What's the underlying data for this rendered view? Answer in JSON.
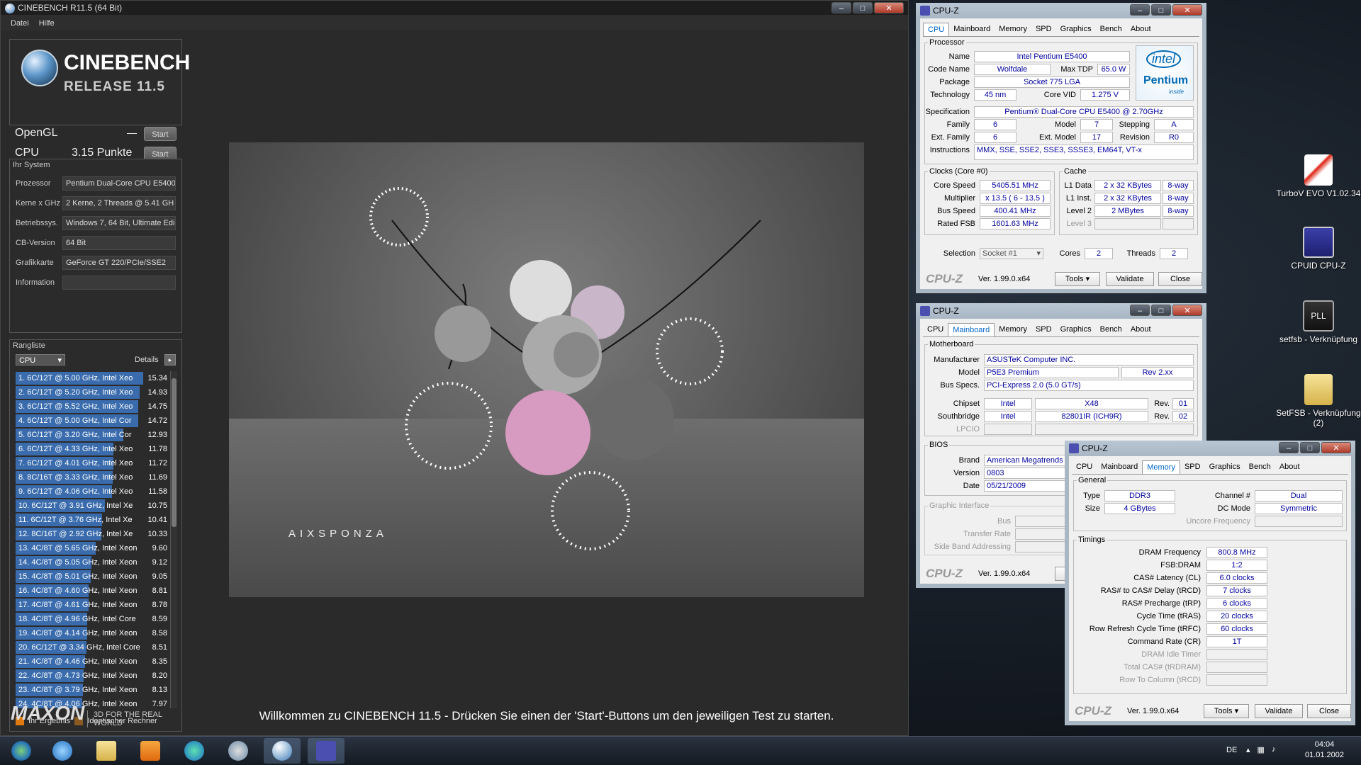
{
  "cinebench": {
    "title": "CINEBENCH R11.5 (64 Bit)",
    "menu": [
      "Datei",
      "Hilfe"
    ],
    "logo_line1": "CINEBENCH",
    "logo_line2": "RELEASE 11.5",
    "opengl_label": "OpenGL",
    "opengl_value": "—",
    "cpu_label": "CPU",
    "cpu_value": "3.15 Punkte",
    "start": "Start",
    "system_title": "Ihr System",
    "system": [
      {
        "k": "Prozessor",
        "v": "Pentium Dual-Core CPU E5400"
      },
      {
        "k": "Kerne x GHz",
        "v": "2 Kerne, 2 Threads @ 5.41 GH"
      },
      {
        "k": "Betriebssys.",
        "v": "Windows 7, 64 Bit, Ultimate Edi"
      },
      {
        "k": "CB-Version",
        "v": "64 Bit"
      },
      {
        "k": "Grafikkarte",
        "v": "GeForce GT 220/PCIe/SSE2"
      },
      {
        "k": "Information",
        "v": ""
      }
    ],
    "rank_title": "Rangliste",
    "rank_select": "CPU",
    "rank_details": "Details",
    "ranking": [
      {
        "t": "1. 6C/12T @ 5.00 GHz, Intel Xeo",
        "s": "15.34"
      },
      {
        "t": "2. 6C/12T @ 5.20 GHz, Intel Xeo",
        "s": "14.93"
      },
      {
        "t": "3. 6C/12T @ 5.52 GHz, Intel Xeo",
        "s": "14.75"
      },
      {
        "t": "4. 6C/12T @ 5.00 GHz, Intel Cor",
        "s": "14.72"
      },
      {
        "t": "5. 6C/12T @ 3.20 GHz, Intel Cor",
        "s": "12.93"
      },
      {
        "t": "6. 6C/12T @ 4.33 GHz, Intel Xeo",
        "s": "11.78"
      },
      {
        "t": "7. 6C/12T @ 4.01 GHz, Intel Xeo",
        "s": "11.72"
      },
      {
        "t": "8. 8C/16T @ 3.33 GHz, Intel Xeo",
        "s": "11.69"
      },
      {
        "t": "9. 6C/12T @ 4.06 GHz, Intel Xeo",
        "s": "11.58"
      },
      {
        "t": "10. 6C/12T @ 3.91 GHz, Intel Xe",
        "s": "10.75"
      },
      {
        "t": "11. 6C/12T @ 3.76 GHz, Intel Xe",
        "s": "10.41"
      },
      {
        "t": "12. 8C/16T @ 2.92 GHz, Intel Xe",
        "s": "10.33"
      },
      {
        "t": "13. 4C/8T @ 5.65 GHz, Intel Xeon",
        "s": "9.60"
      },
      {
        "t": "14. 4C/8T @ 5.05 GHz, Intel Xeon",
        "s": "9.12"
      },
      {
        "t": "15. 4C/8T @ 5.01 GHz, Intel Xeon",
        "s": "9.05"
      },
      {
        "t": "16. 4C/8T @ 4.60 GHz, Intel Xeon",
        "s": "8.81"
      },
      {
        "t": "17. 4C/8T @ 4.61 GHz, Intel Xeon",
        "s": "8.78"
      },
      {
        "t": "18. 4C/8T @ 4.96 GHz, Intel Core",
        "s": "8.59"
      },
      {
        "t": "19. 4C/8T @ 4.14 GHz, Intel Xeon",
        "s": "8.58"
      },
      {
        "t": "20. 6C/12T @ 3.34 GHz, Intel Core",
        "s": "8.51"
      },
      {
        "t": "21. 4C/8T @ 4.46 GHz, Intel Xeon",
        "s": "8.35"
      },
      {
        "t": "22. 4C/8T @ 4.73 GHz, Intel Xeon",
        "s": "8.20"
      },
      {
        "t": "23. 4C/8T @ 3.79 GHz, Intel Xeon",
        "s": "8.13"
      },
      {
        "t": "24. 4C/8T @ 4.06 GHz, Intel Xeon",
        "s": "7.97"
      }
    ],
    "legend_yours": "Ihr Ergebnis",
    "legend_identical": "Identischer Rechner",
    "maxon": "MAXON",
    "maxon_sub": "3D FOR THE REAL WORLD",
    "render_brand": "AIXSPONZA",
    "welcome": "Willkommen zu CINEBENCH 11.5 - Drücken Sie einen der 'Start'-Buttons um den jeweiligen Test zu starten."
  },
  "cpuz_tabs": [
    "CPU",
    "Mainboard",
    "Memory",
    "SPD",
    "Graphics",
    "Bench",
    "About"
  ],
  "cpuz_title": "CPU-Z",
  "cpuz_footer": {
    "brand": "CPU-Z",
    "version": "Ver. 1.99.0.x64",
    "tools": "Tools",
    "validate": "Validate",
    "close": "Close"
  },
  "cpu": {
    "processor": "Processor",
    "name_l": "Name",
    "name": "Intel Pentium E5400",
    "code_l": "Code Name",
    "code": "Wolfdale",
    "tdp_l": "Max TDP",
    "tdp": "65.0 W",
    "pkg_l": "Package",
    "pkg": "Socket 775 LGA",
    "tech_l": "Technology",
    "tech": "45 nm",
    "vid_l": "Core VID",
    "vid": "1.275 V",
    "spec_l": "Specification",
    "spec": "Pentium® Dual-Core  CPU    E5400  @ 2.70GHz",
    "fam_l": "Family",
    "fam": "6",
    "model_l": "Model",
    "model": "7",
    "step_l": "Stepping",
    "step": "A",
    "efam_l": "Ext. Family",
    "efam": "6",
    "emod_l": "Ext. Model",
    "emod": "17",
    "rev_l": "Revision",
    "rev": "R0",
    "inst_l": "Instructions",
    "inst": "MMX, SSE, SSE2, SSE3, SSSE3, EM64T, VT-x",
    "clocks": "Clocks (Core #0)",
    "cache": "Cache",
    "cs_l": "Core Speed",
    "cs": "5405.51 MHz",
    "mult_l": "Multiplier",
    "mult": "x 13.5 ( 6 - 13.5 )",
    "bus_l": "Bus Speed",
    "bus": "400.41 MHz",
    "fsb_l": "Rated FSB",
    "fsb": "1601.63 MHz",
    "l1d_l": "L1 Data",
    "l1d": "2 x 32 KBytes",
    "l1d_w": "8-way",
    "l1i_l": "L1 Inst.",
    "l1i": "2 x 32 KBytes",
    "l1i_w": "8-way",
    "l2_l": "Level 2",
    "l2": "2 MBytes",
    "l2_w": "8-way",
    "l3_l": "Level 3",
    "sel_l": "Selection",
    "sel": "Socket #1",
    "cores_l": "Cores",
    "cores": "2",
    "thr_l": "Threads",
    "thr": "2",
    "intel1": "intel",
    "intel2": "Pentium",
    "intel3": "inside"
  },
  "mb": {
    "mb": "Motherboard",
    "man_l": "Manufacturer",
    "man": "ASUSTeK Computer INC.",
    "model_l": "Model",
    "model": "P5E3 Premium",
    "rev": "Rev 2.xx",
    "bs_l": "Bus Specs.",
    "bs": "PCI-Express 2.0 (5.0 GT/s)",
    "chip_l": "Chipset",
    "chip_v": "Intel",
    "chip": "X48",
    "rev_l": "Rev.",
    "chip_r": "01",
    "sb_l": "Southbridge",
    "sb_v": "Intel",
    "sb": "82801IR (ICH9R)",
    "sb_r": "02",
    "lpcio_l": "LPCIO",
    "bios": "BIOS",
    "brand_l": "Brand",
    "brand": "American Megatrends I",
    "ver_l": "Version",
    "ver": "0803",
    "date_l": "Date",
    "date": "05/21/2009",
    "gi": "Graphic Interface",
    "gi_bus": "Bus",
    "gi_tr": "Transfer Rate",
    "gi_sba": "Side Band Addressing"
  },
  "mem": {
    "general": "General",
    "type_l": "Type",
    "type": "DDR3",
    "ch_l": "Channel #",
    "ch": "Dual",
    "size_l": "Size",
    "size": "4 GBytes",
    "dc_l": "DC Mode",
    "dc": "Symmetric",
    "unc_l": "Uncore Frequency",
    "timings": "Timings",
    "rows": [
      {
        "k": "DRAM Frequency",
        "v": "800.8 MHz",
        "on": true
      },
      {
        "k": "FSB:DRAM",
        "v": "1:2",
        "on": true
      },
      {
        "k": "CAS# Latency (CL)",
        "v": "6.0 clocks",
        "on": true
      },
      {
        "k": "RAS# to CAS# Delay (tRCD)",
        "v": "7 clocks",
        "on": true
      },
      {
        "k": "RAS# Precharge (tRP)",
        "v": "6 clocks",
        "on": true
      },
      {
        "k": "Cycle Time (tRAS)",
        "v": "20 clocks",
        "on": true
      },
      {
        "k": "Row Refresh Cycle Time (tRFC)",
        "v": "60 clocks",
        "on": true
      },
      {
        "k": "Command Rate (CR)",
        "v": "1T",
        "on": true
      },
      {
        "k": "DRAM Idle Timer",
        "v": "",
        "on": false
      },
      {
        "k": "Total CAS# (tRDRAM)",
        "v": "",
        "on": false
      },
      {
        "k": "Row To Column (tRCD)",
        "v": "",
        "on": false
      }
    ]
  },
  "desktop_icons": [
    "TurboV EVO V1.02.34",
    "CPUID CPU-Z",
    "setfsb - Verknüpfung",
    "SetFSB - Verknüpfung (2)"
  ],
  "taskbar": {
    "lang": "DE",
    "time": "04:04",
    "date": "01.01.2002"
  }
}
